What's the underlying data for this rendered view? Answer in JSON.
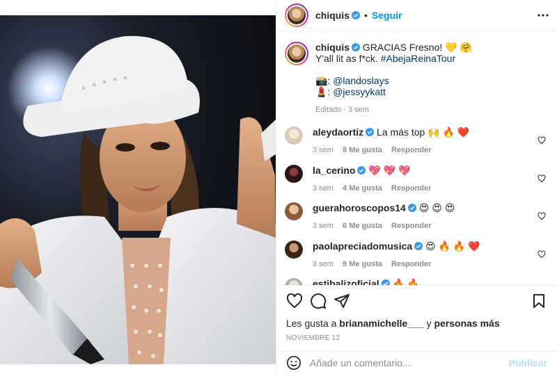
{
  "post": {
    "username": "chiquis",
    "follow_label": "Seguir",
    "separator": "•"
  },
  "caption": {
    "username": "chiquis",
    "line1": "GRACIAS Fresno! 💛 🤗",
    "line2_text": "Y'all lit as f*ck. ",
    "line2_tag": "#AbejaReinaTour",
    "credit1_emoji": "📸: ",
    "credit1_handle": "@landoslays",
    "credit2_emoji": "💄: ",
    "credit2_handle": "@jessyykatt",
    "meta": "Editado · 3 sem"
  },
  "comments": [
    {
      "username": "aleydaortiz",
      "text": "La más top 🙌 🔥 ❤️",
      "time": "3 sem",
      "likes": "8 Me gusta",
      "reply": "Responder",
      "avatar_color": "#d9cbb8"
    },
    {
      "username": "la_cerino",
      "text": "💖 💖 💖",
      "time": "3 sem",
      "likes": "4 Me gusta",
      "reply": "Responder",
      "avatar_color": "#3a1f22"
    },
    {
      "username": "guerahoroscopos14",
      "text": "😍 😍 😍",
      "time": "3 sem",
      "likes": "6 Me gusta",
      "reply": "Responder",
      "avatar_color": "#9a6f4e"
    },
    {
      "username": "paolapreciadomusica",
      "text": "😍 🔥 🔥 ❤️",
      "time": "3 sem",
      "likes": "9 Me gusta",
      "reply": "Responder",
      "avatar_color": "#5a3a2a"
    },
    {
      "username": "estibalizoficial",
      "text": "🔥 🔥",
      "time": "",
      "likes": "",
      "reply": "",
      "avatar_color": "#c9c2bb"
    }
  ],
  "likes": {
    "prefix": "Les gusta a ",
    "user": "brianamichelle___",
    "middle": " y ",
    "others": "personas más"
  },
  "date": "NOVIEMBRE 12",
  "add_comment": {
    "placeholder": "Añade un comentario...",
    "post_label": "Publicar"
  },
  "icons": {
    "verified": "verified-badge-icon",
    "more": "more-options-icon",
    "like": "heart-icon",
    "comment": "comment-bubble-icon",
    "share": "paper-plane-icon",
    "save": "bookmark-icon",
    "emoji": "emoji-smile-icon"
  },
  "colors": {
    "accent": "#0095f6",
    "link": "#00376b",
    "muted": "#8e8e8e",
    "verified": "#3897f0",
    "publish_disabled": "#b2dffc"
  }
}
